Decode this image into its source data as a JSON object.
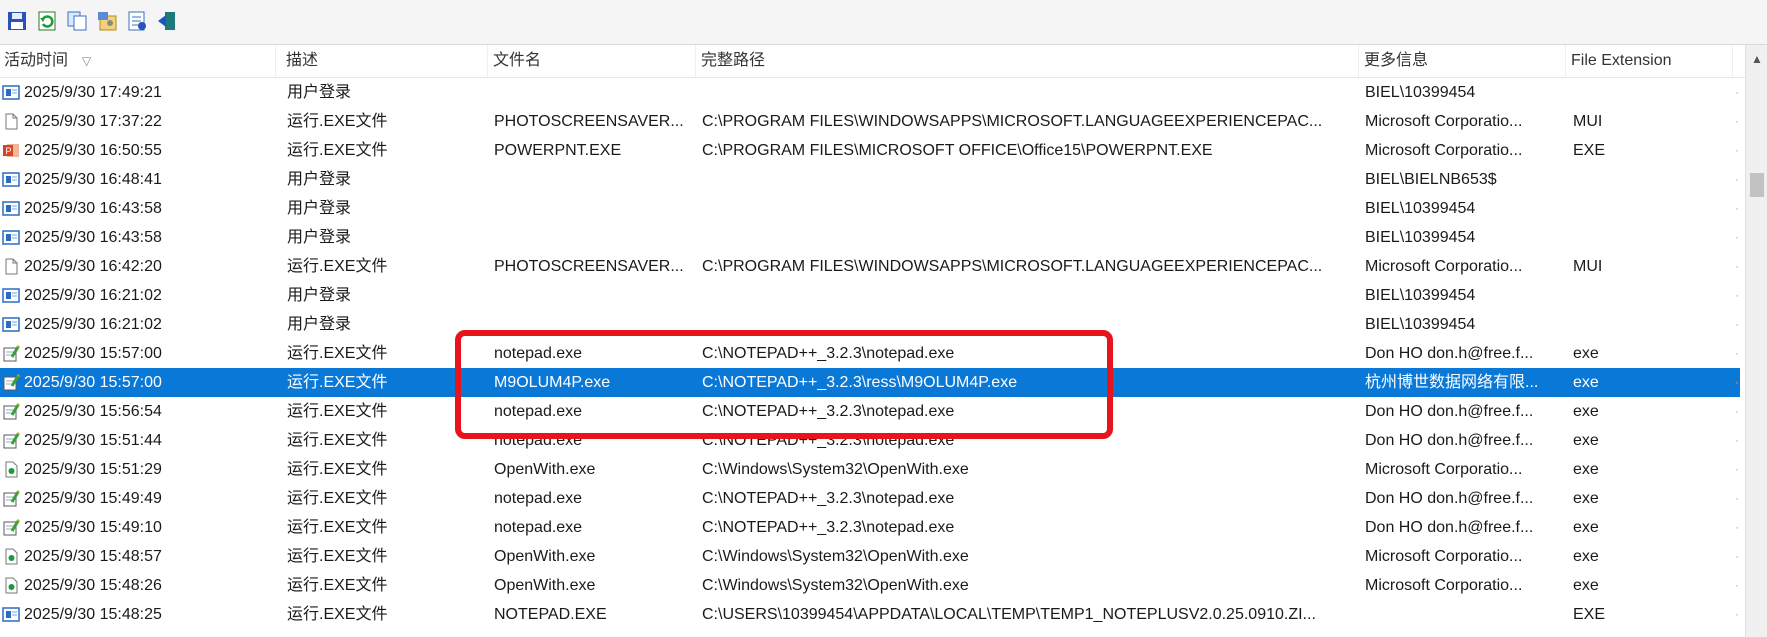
{
  "toolbar": {
    "buttons": [
      "save-icon",
      "refresh-icon",
      "copy-icon",
      "properties-icon",
      "html-report-icon",
      "exit-icon"
    ]
  },
  "table": {
    "columns": [
      "活动时间",
      "描述",
      "文件名",
      "完整路径",
      "更多信息",
      "File Extension"
    ],
    "sort_indicator": "▽",
    "rows": [
      {
        "icon": "logon-icon",
        "time": "2025/9/30 17:49:21",
        "desc": "用户登录",
        "file": "",
        "path": "",
        "info": "BIEL\\10399454",
        "ext": ""
      },
      {
        "icon": "blank-file-icon",
        "time": "2025/9/30 17:37:22",
        "desc": "运行.EXE文件",
        "file": "PHOTOSCREENSAVER...",
        "path": "C:\\PROGRAM FILES\\WINDOWSAPPS\\MICROSOFT.LANGUAGEEXPERIENCEPAC...",
        "info": "Microsoft Corporatio...",
        "ext": "MUI"
      },
      {
        "icon": "powerpoint-icon",
        "time": "2025/9/30 16:50:55",
        "desc": "运行.EXE文件",
        "file": "POWERPNT.EXE",
        "path": "C:\\PROGRAM FILES\\MICROSOFT OFFICE\\Office15\\POWERPNT.EXE",
        "info": "Microsoft Corporatio...",
        "ext": "EXE"
      },
      {
        "icon": "logon-icon",
        "time": "2025/9/30 16:48:41",
        "desc": "用户登录",
        "file": "",
        "path": "",
        "info": "BIEL\\BIELNB653$",
        "ext": ""
      },
      {
        "icon": "logon-icon",
        "time": "2025/9/30 16:43:58",
        "desc": "用户登录",
        "file": "",
        "path": "",
        "info": "BIEL\\10399454",
        "ext": ""
      },
      {
        "icon": "logon-icon",
        "time": "2025/9/30 16:43:58",
        "desc": "用户登录",
        "file": "",
        "path": "",
        "info": "BIEL\\10399454",
        "ext": ""
      },
      {
        "icon": "blank-file-icon",
        "time": "2025/9/30 16:42:20",
        "desc": "运行.EXE文件",
        "file": "PHOTOSCREENSAVER...",
        "path": "C:\\PROGRAM FILES\\WINDOWSAPPS\\MICROSOFT.LANGUAGEEXPERIENCEPAC...",
        "info": "Microsoft Corporatio...",
        "ext": "MUI"
      },
      {
        "icon": "logon-icon",
        "time": "2025/9/30 16:21:02",
        "desc": "用户登录",
        "file": "",
        "path": "",
        "info": "BIEL\\10399454",
        "ext": ""
      },
      {
        "icon": "logon-icon",
        "time": "2025/9/30 16:21:02",
        "desc": "用户登录",
        "file": "",
        "path": "",
        "info": "BIEL\\10399454",
        "ext": ""
      },
      {
        "icon": "notepad-icon",
        "time": "2025/9/30 15:57:00",
        "desc": "运行.EXE文件",
        "file": "notepad.exe",
        "path": "C:\\NOTEPAD++_3.2.3\\notepad.exe",
        "info": "Don HO don.h@free.f...",
        "ext": "exe"
      },
      {
        "icon": "notepad-icon",
        "time": "2025/9/30 15:57:00",
        "desc": "运行.EXE文件",
        "file": "M9OLUM4P.exe",
        "path": "C:\\NOTEPAD++_3.2.3\\ress\\M9OLUM4P.exe",
        "info": "杭州博世数据网络有限...",
        "ext": "exe",
        "selected": true
      },
      {
        "icon": "notepad-icon",
        "time": "2025/9/30 15:56:54",
        "desc": "运行.EXE文件",
        "file": "notepad.exe",
        "path": "C:\\NOTEPAD++_3.2.3\\notepad.exe",
        "info": "Don HO don.h@free.f...",
        "ext": "exe"
      },
      {
        "icon": "notepad-icon",
        "time": "2025/9/30 15:51:44",
        "desc": "运行.EXE文件",
        "file": "notepad.exe",
        "path": "C:\\NOTEPAD++_3.2.3\\notepad.exe",
        "info": "Don HO don.h@free.f...",
        "ext": "exe"
      },
      {
        "icon": "openwith-icon",
        "time": "2025/9/30 15:51:29",
        "desc": "运行.EXE文件",
        "file": "OpenWith.exe",
        "path": "C:\\Windows\\System32\\OpenWith.exe",
        "info": "Microsoft Corporatio...",
        "ext": "exe"
      },
      {
        "icon": "notepad-icon",
        "time": "2025/9/30 15:49:49",
        "desc": "运行.EXE文件",
        "file": "notepad.exe",
        "path": "C:\\NOTEPAD++_3.2.3\\notepad.exe",
        "info": "Don HO don.h@free.f...",
        "ext": "exe"
      },
      {
        "icon": "notepad-icon",
        "time": "2025/9/30 15:49:10",
        "desc": "运行.EXE文件",
        "file": "notepad.exe",
        "path": "C:\\NOTEPAD++_3.2.3\\notepad.exe",
        "info": "Don HO don.h@free.f...",
        "ext": "exe"
      },
      {
        "icon": "openwith-icon",
        "time": "2025/9/30 15:48:57",
        "desc": "运行.EXE文件",
        "file": "OpenWith.exe",
        "path": "C:\\Windows\\System32\\OpenWith.exe",
        "info": "Microsoft Corporatio...",
        "ext": "exe"
      },
      {
        "icon": "openwith-icon",
        "time": "2025/9/30 15:48:26",
        "desc": "运行.EXE文件",
        "file": "OpenWith.exe",
        "path": "C:\\Windows\\System32\\OpenWith.exe",
        "info": "Microsoft Corporatio...",
        "ext": "exe"
      },
      {
        "icon": "logon-icon",
        "time": "2025/9/30 15:48:25",
        "desc": "运行.EXE文件",
        "file": "NOTEPAD.EXE",
        "path": "C:\\USERS\\10399454\\APPDATA\\LOCAL\\TEMP\\TEMP1_NOTEPLUSV2.0.25.0910.ZI...",
        "info": "",
        "ext": "EXE"
      }
    ]
  },
  "scrollbar": {
    "up_arrow": "▲"
  },
  "colors": {
    "selection": "#0a78d7",
    "highlight_box": "#e8141c"
  }
}
